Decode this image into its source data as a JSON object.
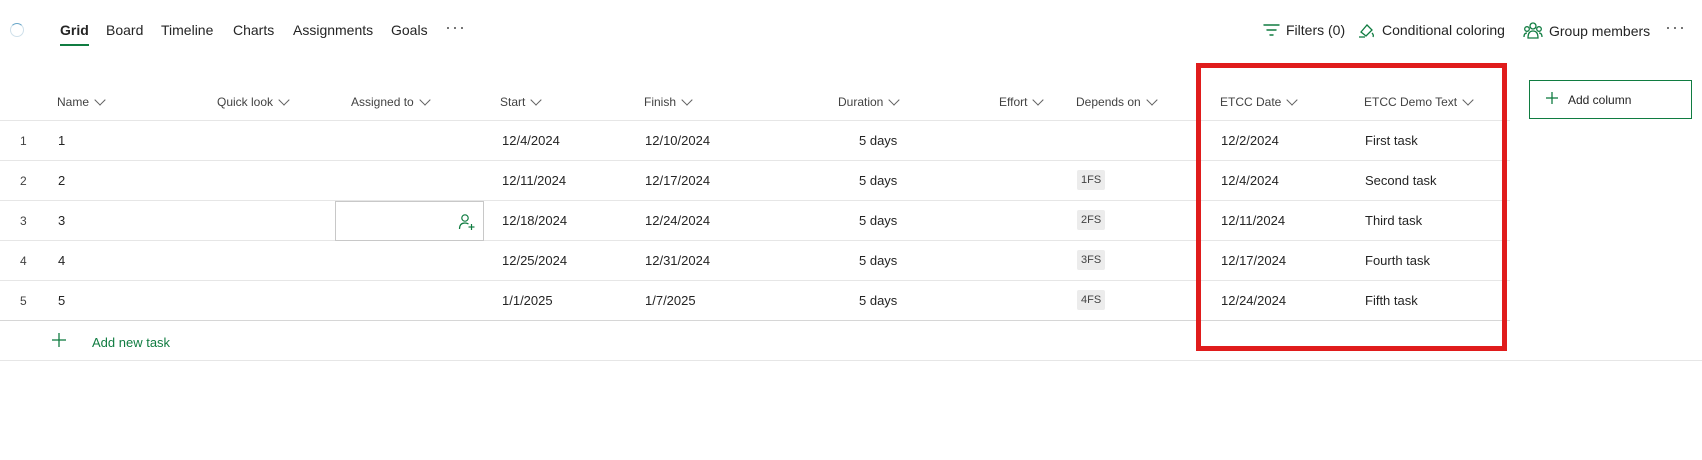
{
  "nav": {
    "tabs": [
      {
        "label": "Grid"
      },
      {
        "label": "Board"
      },
      {
        "label": "Timeline"
      },
      {
        "label": "Charts"
      },
      {
        "label": "Assignments"
      },
      {
        "label": "Goals"
      }
    ],
    "more": "···",
    "active_tab": "Grid"
  },
  "toolbar": {
    "filters_label": "Filters (0)",
    "conditional_label": "Conditional coloring",
    "group_label": "Group members",
    "more": "···"
  },
  "columns": [
    {
      "label": "Name"
    },
    {
      "label": "Quick look"
    },
    {
      "label": "Assigned to"
    },
    {
      "label": "Start"
    },
    {
      "label": "Finish"
    },
    {
      "label": "Duration"
    },
    {
      "label": "Effort"
    },
    {
      "label": "Depends on"
    },
    {
      "label": "ETCC Date"
    },
    {
      "label": "ETCC Demo Text"
    }
  ],
  "add_column_label": "Add column",
  "rows": [
    {
      "num": "1",
      "name": "1",
      "start": "12/4/2024",
      "finish": "12/10/2024",
      "duration": "5 days",
      "depends": "",
      "etcc_date": "12/2/2024",
      "etcc_text": "First task"
    },
    {
      "num": "2",
      "name": "2",
      "start": "12/11/2024",
      "finish": "12/17/2024",
      "duration": "5 days",
      "depends": "1FS",
      "etcc_date": "12/4/2024",
      "etcc_text": "Second task"
    },
    {
      "num": "3",
      "name": "3",
      "start": "12/18/2024",
      "finish": "12/24/2024",
      "duration": "5 days",
      "depends": "2FS",
      "etcc_date": "12/11/2024",
      "etcc_text": "Third task"
    },
    {
      "num": "4",
      "name": "4",
      "start": "12/25/2024",
      "finish": "12/31/2024",
      "duration": "5 days",
      "depends": "3FS",
      "etcc_date": "12/17/2024",
      "etcc_text": "Fourth task"
    },
    {
      "num": "5",
      "name": "5",
      "start": "1/1/2025",
      "finish": "1/7/2025",
      "duration": "5 days",
      "depends": "4FS",
      "etcc_date": "12/24/2024",
      "etcc_text": "Fifth task"
    }
  ],
  "add_task_label": "Add new task",
  "colors": {
    "accent": "#107c41",
    "highlight": "#e01c1c"
  },
  "icons": [
    "loading-spinner-icon",
    "filter-icon",
    "conditional-coloring-icon",
    "group-members-icon",
    "more-icon",
    "chevron-down-icon",
    "plus-icon",
    "add-person-icon"
  ]
}
